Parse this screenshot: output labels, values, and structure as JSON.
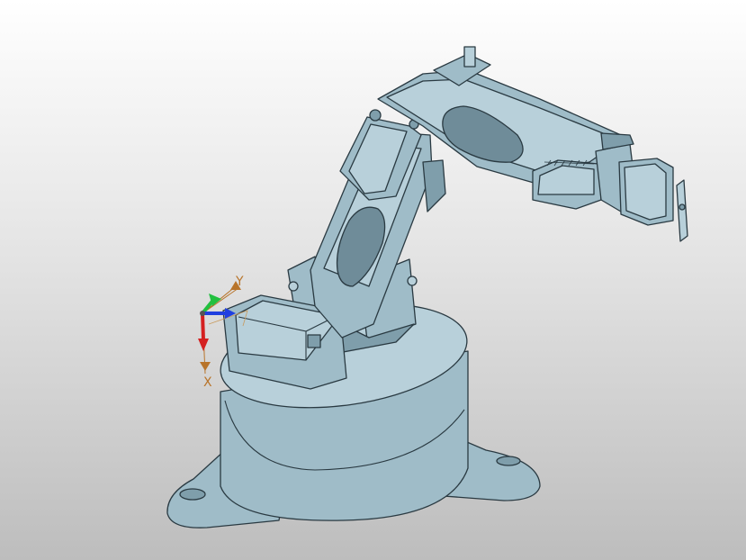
{
  "triad": {
    "x_label": "X",
    "y_label": "Y"
  },
  "colors": {
    "model_fill": "#9fbcc8",
    "model_edge": "#2a3a42",
    "axis_x": "#d42020",
    "axis_y": "#22c040",
    "axis_z": "#2040e0",
    "axis_label": "#b8742a",
    "background_top": "#ffffff",
    "background_bottom": "#bdbdbd"
  }
}
